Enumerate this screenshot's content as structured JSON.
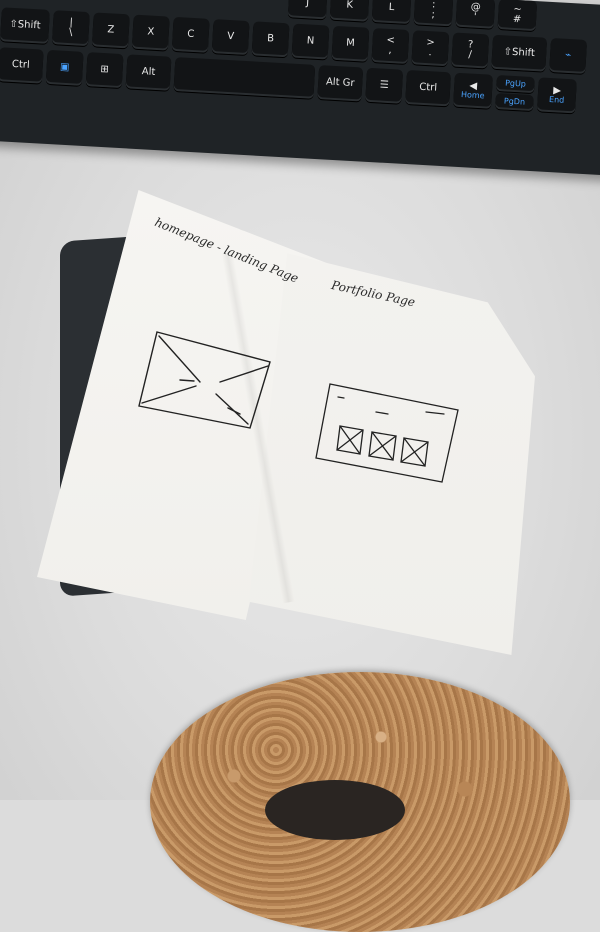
{
  "keyboard": {
    "row1": [
      "⇧Shift",
      "|\n\\",
      "Z",
      "X",
      "C",
      "V",
      "B",
      "N",
      "M",
      "<\n,",
      ">\n.",
      "?\n/",
      "⇧Shift"
    ],
    "row0_partial": [
      "J",
      "K",
      "L",
      ":\n;",
      "@\n'",
      "~\n#"
    ],
    "row2": [
      "Ctrl",
      "Alt",
      "Alt Gr",
      "Ctrl"
    ],
    "nav": {
      "pgup": "PgUp",
      "pgdn": "PgDn",
      "home": "Home",
      "end": "End"
    }
  },
  "notebook": {
    "left_page_note": "homepage - landing Page",
    "right_page_note": "Portfolio Page"
  }
}
